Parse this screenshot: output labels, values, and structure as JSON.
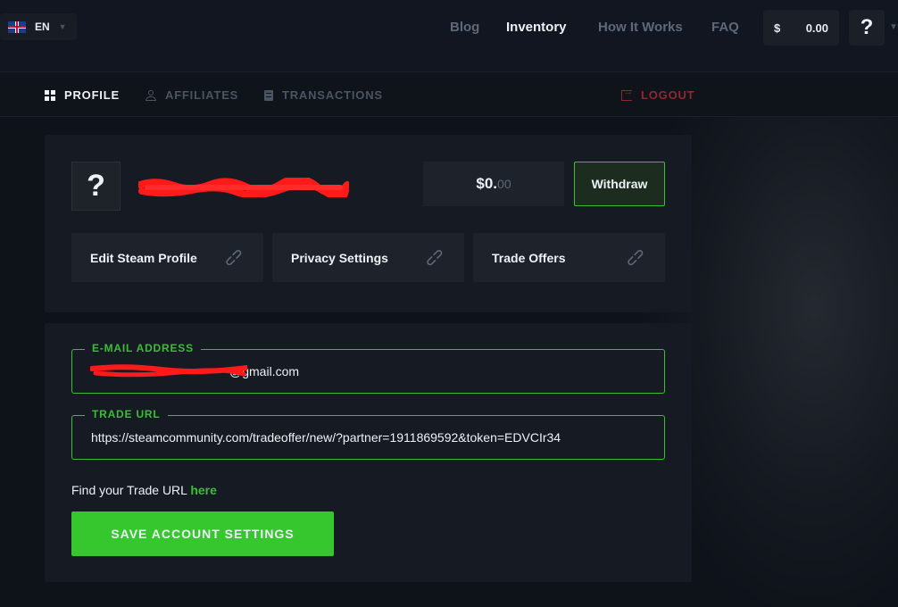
{
  "header": {
    "language": {
      "code": "EN",
      "flag_icon": "uk-flag-icon"
    },
    "nav": [
      {
        "label": "Blog",
        "active": false
      },
      {
        "label": "Inventory",
        "active": true
      },
      {
        "label": "How It Works",
        "active": false
      },
      {
        "label": "FAQ",
        "active": false
      }
    ],
    "balance": {
      "currency": "$",
      "amount": "0.00"
    },
    "help_label": "?"
  },
  "subnav": {
    "profile": "PROFILE",
    "affiliates": "AFFILIATES",
    "transactions": "TRANSACTIONS",
    "logout": "LOGOUT"
  },
  "profile": {
    "avatar_placeholder": "?",
    "username_redacted": "redacted username",
    "balance_main": "$0.",
    "balance_cents": "00",
    "withdraw_label": "Withdraw",
    "links": [
      {
        "label": "Edit Steam Profile",
        "icon": "link-icon"
      },
      {
        "label": "Privacy Settings",
        "icon": "link-icon"
      },
      {
        "label": "Trade Offers",
        "icon": "link-icon"
      }
    ]
  },
  "settings": {
    "email": {
      "label": "E-MAIL ADDRESS",
      "value_visible": "gmail.com",
      "value_prefix": "@"
    },
    "trade_url": {
      "label": "TRADE URL",
      "value": "https://steamcommunity.com/tradeoffer/new/?partner=1911869592&token=EDVCIr34"
    },
    "find_prefix": "Find your Trade URL ",
    "find_link": "here",
    "save_label": "SAVE ACCOUNT SETTINGS"
  },
  "colors": {
    "accent_green": "#3bbd35",
    "logout_red": "#8e2a2f",
    "background": "#0e1219",
    "card": "#161b23"
  }
}
